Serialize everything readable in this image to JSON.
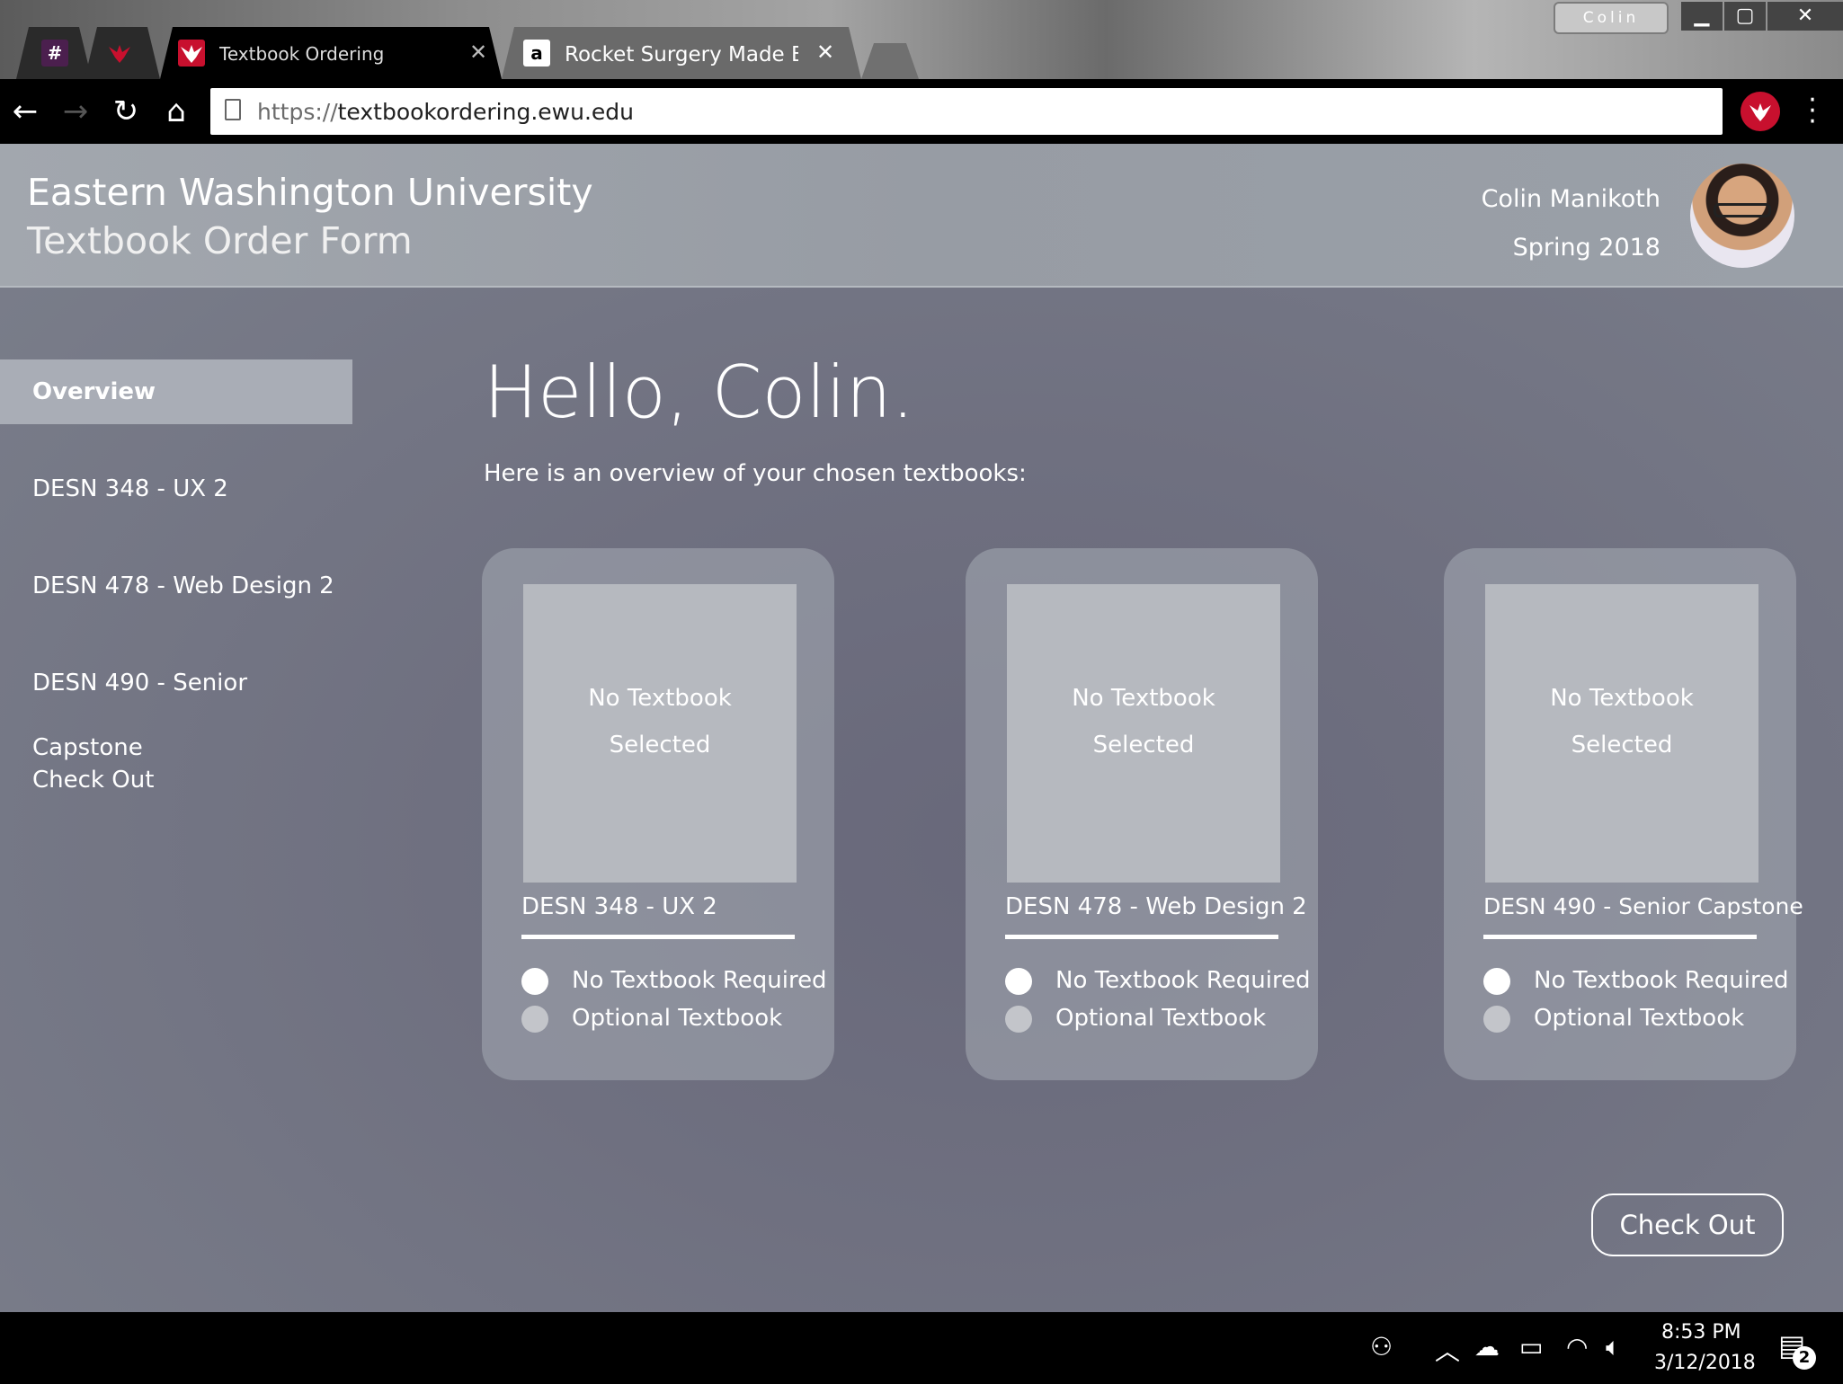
{
  "browser": {
    "profile": "Colin",
    "tabs": [
      {
        "favicon": "#",
        "title": ""
      },
      {
        "favicon": "eagle-logo",
        "title": ""
      },
      {
        "favicon": "eagle-logo",
        "title": "Textbook Ordering"
      },
      {
        "favicon": "a",
        "title": "Rocket Surgery Made Ea"
      }
    ],
    "url_protocol": "https://",
    "url_host": "textbookordering.ewu.edu"
  },
  "header": {
    "university": "Eastern Washington University",
    "form_title": "Textbook Order Form",
    "user_name": "Colin Manikoth",
    "term": "Spring 2018"
  },
  "sidebar": {
    "items": [
      {
        "label": "Overview",
        "active": true
      },
      {
        "label": "DESN 348 - UX 2"
      },
      {
        "label": "DESN 478 - Web Design 2"
      },
      {
        "label": "DESN 490 - Senior Capstone"
      },
      {
        "label": "Check Out"
      }
    ]
  },
  "main": {
    "greeting": "Hello, Colin.",
    "intro": "Here is an overview of your chosen textbooks:",
    "cards": [
      {
        "placeholder_line1": "No Textbook",
        "placeholder_line2": "Selected",
        "course": "DESN 348 - UX 2",
        "option1": "No Textbook Required",
        "option2": "Optional Textbook"
      },
      {
        "placeholder_line1": "No Textbook",
        "placeholder_line2": "Selected",
        "course": "DESN 478 - Web Design 2",
        "option1": "No Textbook Required",
        "option2": "Optional Textbook"
      },
      {
        "placeholder_line1": "No Textbook",
        "placeholder_line2": "Selected",
        "course": "DESN 490 - Senior Capstone",
        "option1": "No Textbook Required",
        "option2": "Optional Textbook"
      }
    ],
    "checkout_label": "Check Out"
  },
  "taskbar": {
    "time": "8:53 PM",
    "date": "3/12/2018",
    "notifications": "2"
  },
  "colors": {
    "brand_red": "#c8102e",
    "page_bg": "#6f6e7a",
    "header_bg": "#9ba0a8"
  }
}
